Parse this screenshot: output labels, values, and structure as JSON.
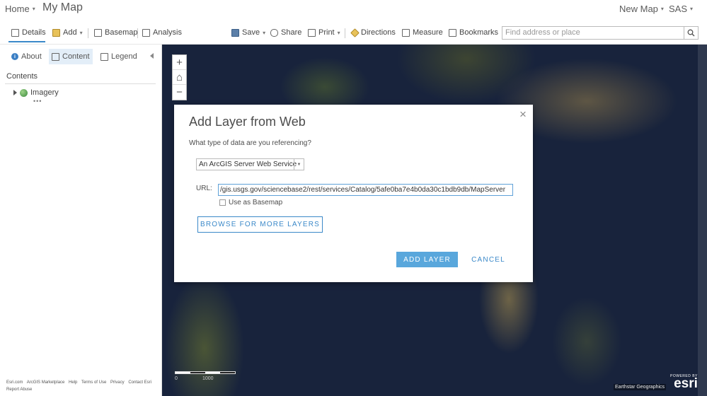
{
  "header": {
    "home_label": "Home",
    "map_title": "My Map",
    "new_map_label": "New Map",
    "user_label": "SAS"
  },
  "toolbar": {
    "details_label": "Details",
    "add_label": "Add",
    "basemap_label": "Basemap",
    "analysis_label": "Analysis",
    "save_label": "Save",
    "share_label": "Share",
    "print_label": "Print",
    "directions_label": "Directions",
    "measure_label": "Measure",
    "bookmarks_label": "Bookmarks",
    "search_placeholder": "Find address or place"
  },
  "left_panel": {
    "tabs": [
      {
        "label": "About"
      },
      {
        "label": "Content"
      },
      {
        "label": "Legend"
      }
    ],
    "contents_heading": "Contents",
    "layers": [
      {
        "label": "Imagery",
        "more": "•••"
      }
    ],
    "footer_links": [
      "Esri.com",
      "ArcGIS Marketplace",
      "Help",
      "Terms of Use",
      "Privacy",
      "Contact Esri",
      "Report Abuse"
    ]
  },
  "map": {
    "zoom_in": "+",
    "home": "⌂",
    "zoom_out": "−",
    "scale_zero": "0",
    "scale_max": "1000",
    "attribution": "Earthstar Geographics",
    "esri_powered": "POWERED BY",
    "esri_word": "esri"
  },
  "dialog": {
    "title": "Add Layer from Web",
    "question": "What type of data are you referencing?",
    "data_type_selected": "An ArcGIS Server Web Service",
    "url_label": "URL:",
    "url_value": "/gis.usgs.gov/sciencebase2/rest/services/Catalog/5afe0ba7e4b0da30c1bdb9db/MapServer",
    "use_as_basemap_label": "Use as Basemap",
    "browse_label": "BROWSE FOR MORE LAYERS",
    "add_layer_label": "ADD LAYER",
    "cancel_label": "CANCEL",
    "close_glyph": "×"
  },
  "colors": {
    "accent": "#3b89c9",
    "primary_button": "#59a7dc"
  }
}
